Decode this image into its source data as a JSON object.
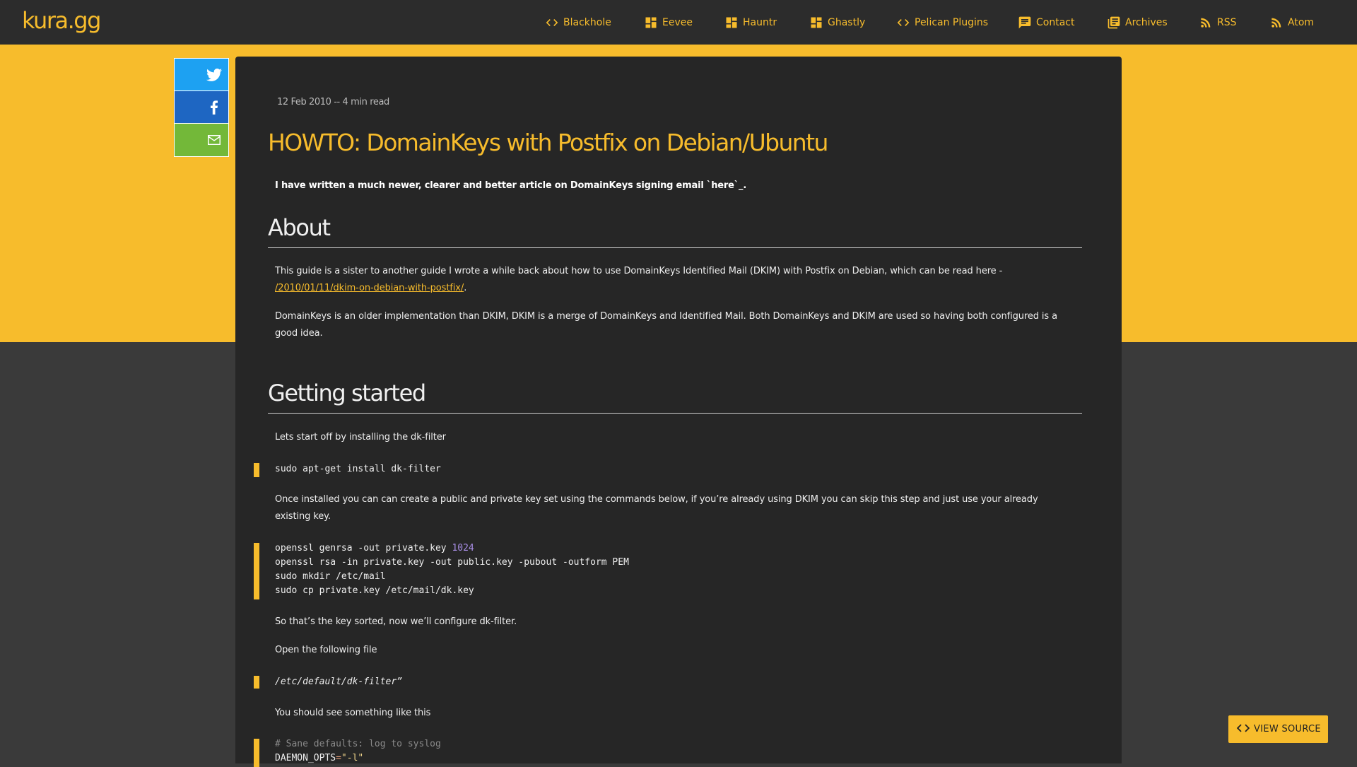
{
  "site": {
    "logo": "kura.gg"
  },
  "nav": [
    {
      "label": "Blackhole",
      "icon": "code-icon"
    },
    {
      "label": "Eevee",
      "icon": "dashboard-icon"
    },
    {
      "label": "Hauntr",
      "icon": "dashboard-icon"
    },
    {
      "label": "Ghastly",
      "icon": "dashboard-icon"
    },
    {
      "label": "Pelican Plugins",
      "icon": "code-icon"
    },
    {
      "label": "Contact",
      "icon": "chat-icon"
    },
    {
      "label": "Archives",
      "icon": "library-icon"
    },
    {
      "label": "RSS",
      "icon": "rss-icon"
    },
    {
      "label": "Atom",
      "icon": "rss-icon"
    }
  ],
  "colors": {
    "accent": "#f7bc2c",
    "twitter": "#1da1f2",
    "facebook": "#1e66c2",
    "email": "#73b839",
    "card": "#262626",
    "page": "#3a3a3a"
  },
  "share": [
    {
      "name": "twitter",
      "icon": "twitter-icon"
    },
    {
      "name": "facebook",
      "icon": "facebook-icon"
    },
    {
      "name": "email",
      "icon": "mail-icon"
    }
  ],
  "article": {
    "meta": "12 Feb 2010 -- 4 min read",
    "title": "HOWTO: DomainKeys with Postfix on Debian/Ubuntu",
    "lede": "I have written a much newer, clearer and better article on DomainKeys signing email `here`_.",
    "about_heading": "About",
    "about_p1_text": "This guide is a sister to another guide I wrote a while back about how to use DomainKeys Identified Mail (DKIM) with Postfix on Debian, which can be read here - ",
    "about_p1_link": "/2010/01/11/dkim-on-debian-with-postfix/",
    "about_p1_end": ".",
    "about_p2": "DomainKeys is an older implementation than DKIM, DKIM is a merge of DomainKeys and Identified Mail. Both DomainKeys and DKIM are used so having both configured is a good idea.",
    "getting_started_heading": "Getting started",
    "gs_p1": "Lets start off by installing the dk-filter",
    "gs_code1": "sudo apt-get install dk-filter",
    "gs_p2": "Once installed you can can create a public and private key set using the commands below, if you’re already using DKIM you can skip this step and just use your already existing key.",
    "gs_code2_line1_a": "openssl genrsa -out private.key ",
    "gs_code2_line1_num": "1024",
    "gs_code2_line2": "openssl rsa -in private.key -out public.key -pubout -outform PEM",
    "gs_code2_line3": "sudo mkdir /etc/mail",
    "gs_code2_line4": "sudo cp private.key /etc/mail/dk.key",
    "gs_p3": "So that’s the key sorted, now we’ll configure dk-filter.",
    "gs_p4": "Open the following file",
    "gs_path": "/etc/default/dk-filter",
    "gs_path_suffix": "”",
    "gs_p5": "You should see something like this",
    "gs_code3_comment": "# Sane defaults: log to syslog",
    "gs_code3_key": "DAEMON_OPTS",
    "gs_code3_eq": "=",
    "gs_code3_val": "\"-l\""
  },
  "view_source": {
    "label": "VIEW SOURCE",
    "icon": "code-icon"
  }
}
